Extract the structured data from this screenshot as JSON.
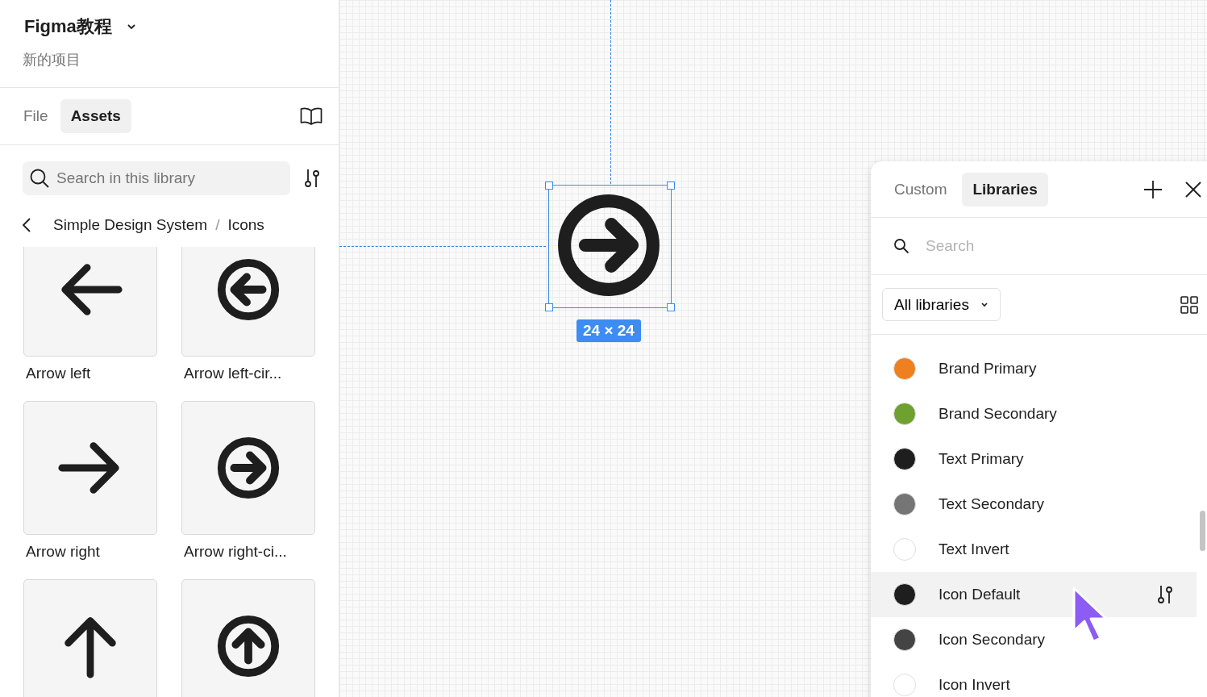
{
  "project": {
    "title": "Figma教程",
    "subtitle": "新的项目"
  },
  "sidebar_tabs": [
    {
      "label": "File",
      "selected": false
    },
    {
      "label": "Assets",
      "selected": true
    }
  ],
  "library_search": {
    "placeholder": "Search in this library"
  },
  "breadcrumb": [
    "Simple Design System",
    "/",
    "Icons"
  ],
  "assets": [
    {
      "label": "Arrow left",
      "kind": "left",
      "circle": false
    },
    {
      "label": "Arrow left-cir...",
      "kind": "left",
      "circle": true
    },
    {
      "label": "Arrow right",
      "kind": "right",
      "circle": false
    },
    {
      "label": "Arrow right-ci...",
      "kind": "right",
      "circle": true
    },
    {
      "kind": "up",
      "circle": false
    },
    {
      "kind": "up",
      "circle": true
    }
  ],
  "canvas": {
    "size_badge": "24 × 24"
  },
  "panel": {
    "tabs": [
      {
        "label": "Custom",
        "selected": false
      },
      {
        "label": "Libraries",
        "selected": true
      }
    ],
    "search": {
      "placeholder": "Search"
    },
    "filter": {
      "value": "All libraries"
    },
    "colors": [
      {
        "name": "Brand Primary",
        "color": "#ee8020",
        "highlighted": false
      },
      {
        "name": "Brand Secondary",
        "color": "#6ea12f",
        "highlighted": false
      },
      {
        "name": "Text Primary",
        "color": "#1e1e1e",
        "highlighted": false
      },
      {
        "name": "Text Secondary",
        "color": "#757575",
        "highlighted": false
      },
      {
        "name": "Text Invert",
        "color": "#ffffff",
        "highlighted": false
      },
      {
        "name": "Icon Default",
        "color": "#1e1e1e",
        "highlighted": true
      },
      {
        "name": "Icon Secondary",
        "color": "#444444",
        "highlighted": false
      },
      {
        "name": "Icon Invert",
        "color": "#ffffff",
        "highlighted": false
      }
    ]
  }
}
